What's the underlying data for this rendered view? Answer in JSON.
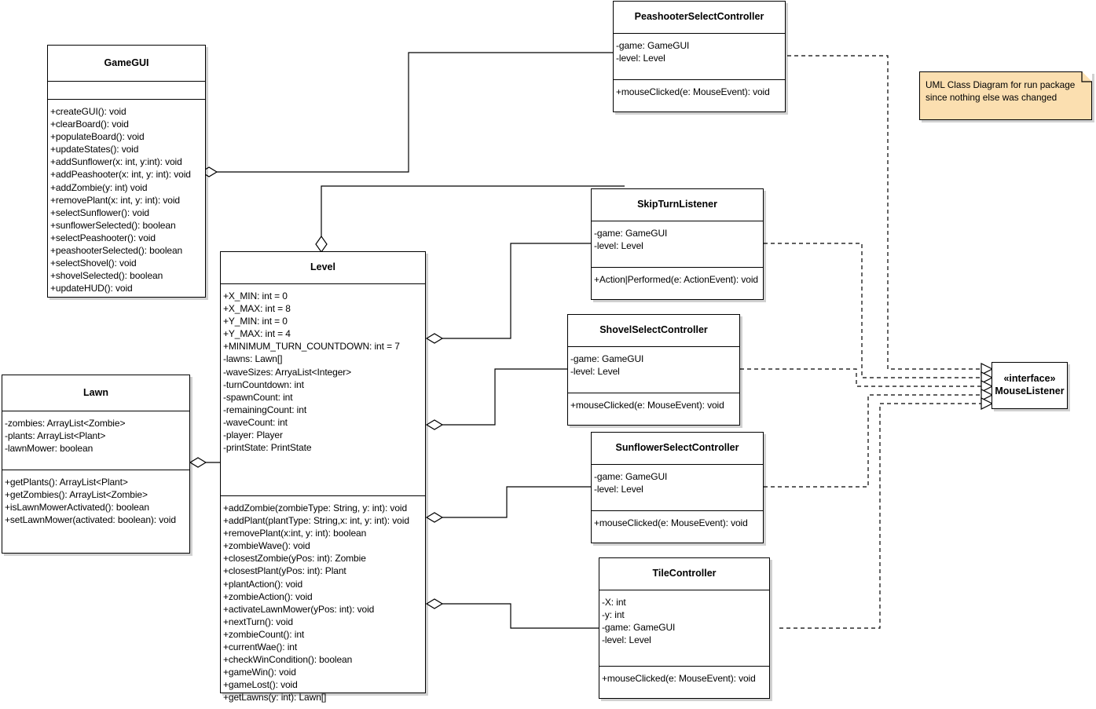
{
  "diagram": {
    "title": "UML Class Diagram for run package",
    "note": {
      "text": "UML Class Diagram for run package\nsince nothing else was changed"
    }
  },
  "classes": {
    "gamegui": {
      "name": "GameGUI",
      "attributes": [],
      "methods": [
        "+createGUI(): void",
        "+clearBoard(): void",
        "+populateBoard(): void",
        "+updateStates(): void",
        "+addSunflower(x: int, y:int): void",
        "+addPeashooter(x: int, y: int): void",
        "+addZombie(y: int) void",
        "+removePlant(x: int, y: int): void",
        "+selectSunflower(): void",
        "+sunflowerSelected(): boolean",
        "+selectPeashooter(): void",
        "+peashooterSelected(): boolean",
        "+selectShovel(): void",
        "+shovelSelected(): boolean",
        "+updateHUD(): void"
      ]
    },
    "lawn": {
      "name": "Lawn",
      "attributes": [
        "-zombies: ArrayList<Zombie>",
        "-plants: ArrayList<Plant>",
        "-lawnMower: boolean"
      ],
      "methods": [
        "+getPlants(): ArrayList<Plant>",
        "+getZombies(): ArrayList<Zombie>",
        "+isLawnMowerActivated(): boolean",
        "+setLawnMower(activated: boolean): void"
      ]
    },
    "level": {
      "name": "Level",
      "attributes": [
        "+X_MIN: int = 0",
        "+X_MAX: int = 8",
        "+Y_MIN: int = 0",
        "+Y_MAX: int = 4",
        "+MINIMUM_TURN_COUNTDOWN: int = 7",
        "-lawns: Lawn[]",
        "-waveSizes: ArryaList<Integer>",
        "-turnCountdown: int",
        "-spawnCount: int",
        "-remainingCount: int",
        "-waveCount: int",
        "-player: Player",
        "-printState: PrintState"
      ],
      "methods": [
        "+addZombie(zombieType: String, y: int): void",
        "+addPlant(plantType: String,x: int, y: int): void",
        "+removePlant(x:int, y: int): boolean",
        "+zombieWave(): void",
        "+closestZombie(yPos: int): Zombie",
        "+closestPlant(yPos: int): Plant",
        "+plantAction(): void",
        "+zombieAction(): void",
        "+activateLawnMower(yPos: int): void",
        "+nextTurn(): void",
        "+zombieCount(): int",
        "+currentWae(): int",
        "+checkWinCondition(): boolean",
        "+gameWin(): void",
        "+gameLost(): void",
        "+getLawns(y: int): Lawn[]"
      ]
    },
    "peashooter_select_controller": {
      "name": "PeashooterSelectController",
      "attributes": [
        "-game: GameGUI",
        "-level: Level"
      ],
      "methods": [
        "+mouseClicked(e: MouseEvent): void"
      ]
    },
    "skip_turn_listener": {
      "name": "SkipTurnListener",
      "attributes": [
        "-game: GameGUI",
        "-level: Level"
      ],
      "methods": [
        "+Action|Performed(e: ActionEvent): void"
      ]
    },
    "shovel_select_controller": {
      "name": "ShovelSelectController",
      "attributes": [
        "-game: GameGUI",
        "-level: Level"
      ],
      "methods": [
        "+mouseClicked(e: MouseEvent): void"
      ]
    },
    "sunflower_select_controller": {
      "name": "SunflowerSelectController",
      "attributes": [
        "-game: GameGUI",
        "-level: Level"
      ],
      "methods": [
        "+mouseClicked(e: MouseEvent): void"
      ]
    },
    "tile_controller": {
      "name": "TileController",
      "attributes": [
        "-X: int",
        "-y: int",
        "-game: GameGUI",
        "-level: Level"
      ],
      "methods": [
        "+mouseClicked(e: MouseEvent): void"
      ]
    },
    "mouse_listener": {
      "stereotype": "«interface»",
      "name": "MouseListener",
      "attributes": [],
      "methods": []
    }
  },
  "colors": {
    "note_fill": "#fbdfb0",
    "line": "#000000",
    "class_fill": "#ffffff"
  }
}
